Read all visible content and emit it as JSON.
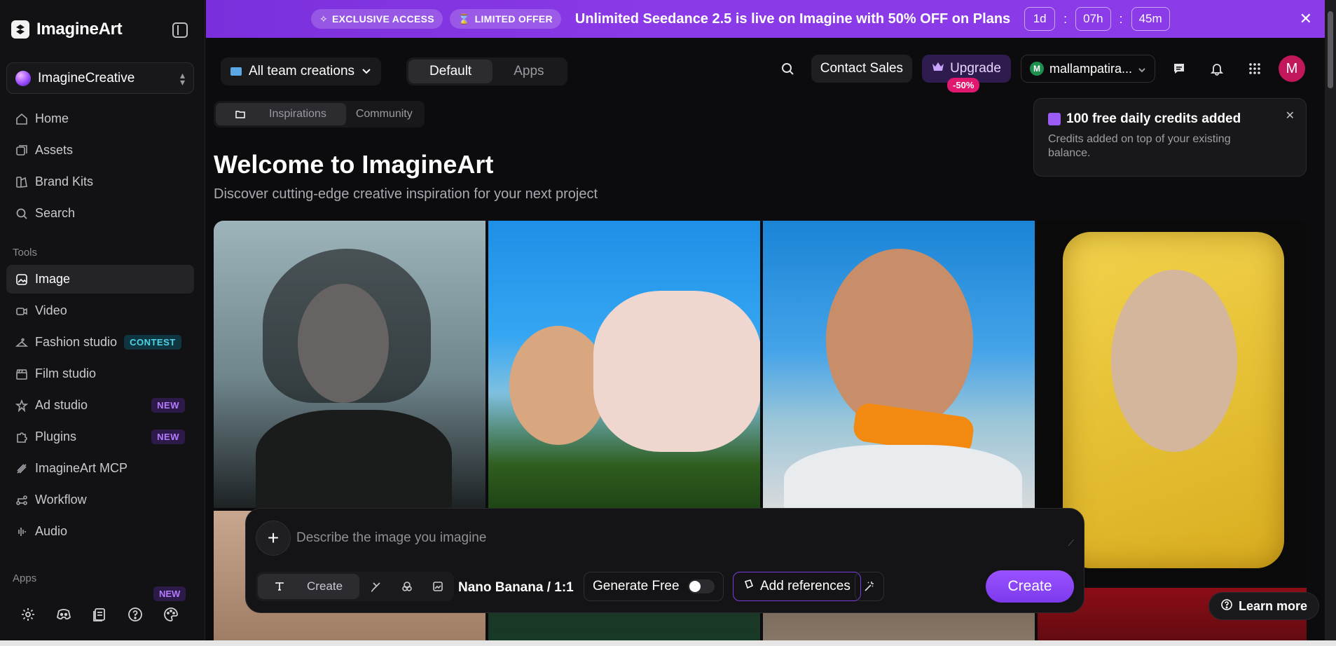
{
  "app": {
    "name": "ImagineArt",
    "workspace": "ImagineCreative"
  },
  "sidebar": {
    "nav": [
      {
        "label": "Home",
        "icon": "home-icon"
      },
      {
        "label": "Assets",
        "icon": "assets-icon"
      },
      {
        "label": "Brand Kits",
        "icon": "brand-kits-icon"
      },
      {
        "label": "Search",
        "icon": "search-icon"
      }
    ],
    "tools_label": "Tools",
    "tools": [
      {
        "label": "Image",
        "icon": "image-icon",
        "active": true
      },
      {
        "label": "Video",
        "icon": "video-icon"
      },
      {
        "label": "Fashion studio",
        "icon": "hanger-icon",
        "badge": "CONTEST"
      },
      {
        "label": "Film studio",
        "icon": "clapper-icon"
      },
      {
        "label": "Ad studio",
        "icon": "ad-icon",
        "badge": "NEW"
      },
      {
        "label": "Plugins",
        "icon": "puzzle-icon",
        "badge": "NEW"
      },
      {
        "label": "ImagineArt MCP",
        "icon": "mcp-icon"
      },
      {
        "label": "Workflow",
        "icon": "workflow-icon"
      },
      {
        "label": "Audio",
        "icon": "audio-icon"
      }
    ],
    "apps_label": "Apps",
    "apps_badge": "NEW"
  },
  "promo": {
    "exclusive": "EXCLUSIVE ACCESS",
    "limited": "LIMITED OFFER",
    "text": "Unlimited Seedance 2.5 is live on Imagine with 50% OFF on Plans",
    "timer": {
      "days": "1d",
      "hours": "07h",
      "minutes": "45m"
    },
    "sep": ":"
  },
  "topbar": {
    "view_select": "All team creations",
    "segments": {
      "default": "Default",
      "apps": "Apps"
    },
    "contact_sales": "Contact Sales",
    "upgrade": "Upgrade",
    "upgrade_discount": "-50%",
    "account_initial": "M",
    "account_name": "mallampatira...",
    "avatar_initial": "M"
  },
  "subtabs": {
    "inspirations": "Inspirations",
    "community": "Community"
  },
  "main": {
    "title": "Welcome to ImagineArt",
    "subtitle": "Discover cutting-edge creative inspiration for your next project"
  },
  "toast": {
    "title": "100 free daily credits added",
    "description": "Credits added on top of your existing balance."
  },
  "prompt": {
    "placeholder": "Describe the image you imagine",
    "create_tab": "Create",
    "model": "Nano Banana / 1:1",
    "generate_free": "Generate Free",
    "add_references": "Add references",
    "create_button": "Create"
  },
  "learn_more": "Learn more",
  "colors": {
    "accent": "#7c3aed",
    "promo": "#8a3ae6",
    "discount": "#e0186f"
  }
}
